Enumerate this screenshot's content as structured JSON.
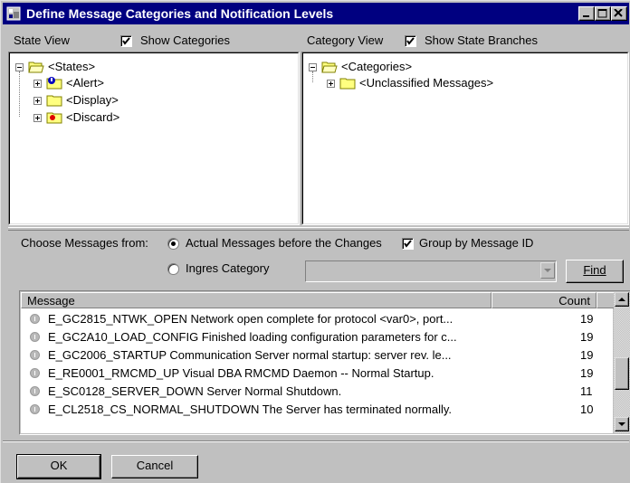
{
  "window": {
    "title": "Define Message Categories and Notification Levels"
  },
  "state_view": {
    "label": "State View",
    "show_categories_label": "Show Categories",
    "show_categories_checked": true,
    "tree": {
      "root": "<States>",
      "children": [
        {
          "label": "<Alert>",
          "icon": "folder-alert-icon"
        },
        {
          "label": "<Display>",
          "icon": "folder-display-icon"
        },
        {
          "label": "<Discard>",
          "icon": "folder-discard-icon"
        }
      ]
    }
  },
  "category_view": {
    "label": "Category View",
    "show_state_branches_label": "Show State Branches",
    "show_state_branches_checked": true,
    "tree": {
      "root": "<Categories>",
      "children": [
        {
          "label": "<Unclassified Messages>",
          "icon": "folder-icon"
        }
      ]
    }
  },
  "filters": {
    "choose_label": "Choose Messages from:",
    "actual_messages_label": "Actual Messages before the Changes",
    "actual_messages_selected": true,
    "group_by_label": "Group by Message ID",
    "group_by_checked": true,
    "ingres_category_label": "Ingres Category",
    "ingres_category_selected": false,
    "ingres_category_value": "",
    "find_label": "Find"
  },
  "messages": {
    "columns": {
      "message": "Message",
      "count": "Count"
    },
    "rows": [
      {
        "text": "E_GC2815_NTWK_OPEN Network open complete for protocol <var0>, port...",
        "count": "19"
      },
      {
        "text": "E_GC2A10_LOAD_CONFIG Finished loading configuration parameters for c...",
        "count": "19"
      },
      {
        "text": "E_GC2006_STARTUP Communication Server normal startup: server rev. le...",
        "count": "19"
      },
      {
        "text": "E_RE0001_RMCMD_UP Visual DBA RMCMD Daemon -- Normal Startup.",
        "count": "19"
      },
      {
        "text": "E_SC0128_SERVER_DOWN Server Normal Shutdown.",
        "count": "11"
      },
      {
        "text": "E_CL2518_CS_NORMAL_SHUTDOWN The Server has terminated normally.",
        "count": "10"
      }
    ]
  },
  "buttons": {
    "ok": "OK",
    "cancel": "Cancel"
  },
  "colors": {
    "title_bar": "#000080",
    "face": "#c0c0c0",
    "window_bg": "#ffffff"
  }
}
